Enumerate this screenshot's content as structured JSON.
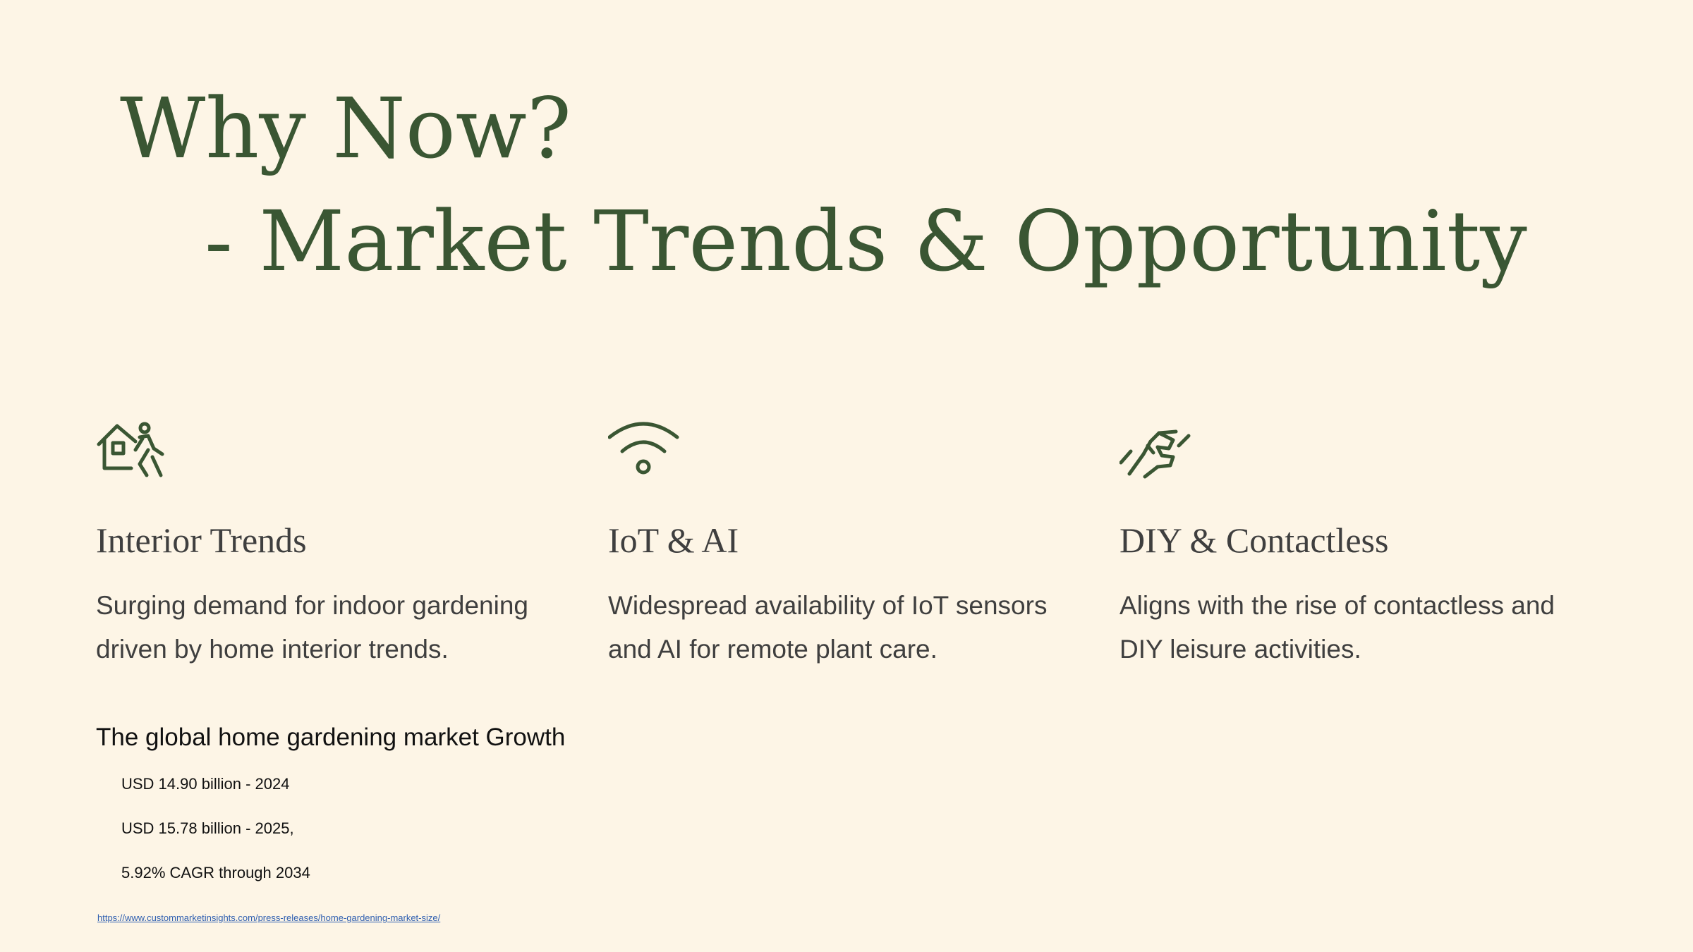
{
  "slide": {
    "title_line_1": "Why Now?",
    "title_line_2": "- Market Trends & Opportunity",
    "accent_color": "#3a5633",
    "background_color": "#fdf5e6"
  },
  "columns": [
    {
      "icon": "home-person-walking-icon",
      "heading": "Interior Trends",
      "description": "Surging demand for indoor gardening driven by home interior trends."
    },
    {
      "icon": "wifi-icon",
      "heading": "IoT & AI",
      "description": "Widespread availability of IoT sensors and AI for remote plant care."
    },
    {
      "icon": "handshake-icon",
      "heading": "DIY & Contactless",
      "description": "Aligns with the rise of contactless and DIY leisure activities."
    }
  ],
  "market": {
    "heading": "The global home gardening market Growth",
    "items": [
      "USD 14.90 billion - 2024",
      "USD 15.78 billion - 2025,",
      "5.92% CAGR through 2034"
    ],
    "source_url": " https://www.custommarketinsights.com/press-releases/home-gardening-market-size/"
  }
}
